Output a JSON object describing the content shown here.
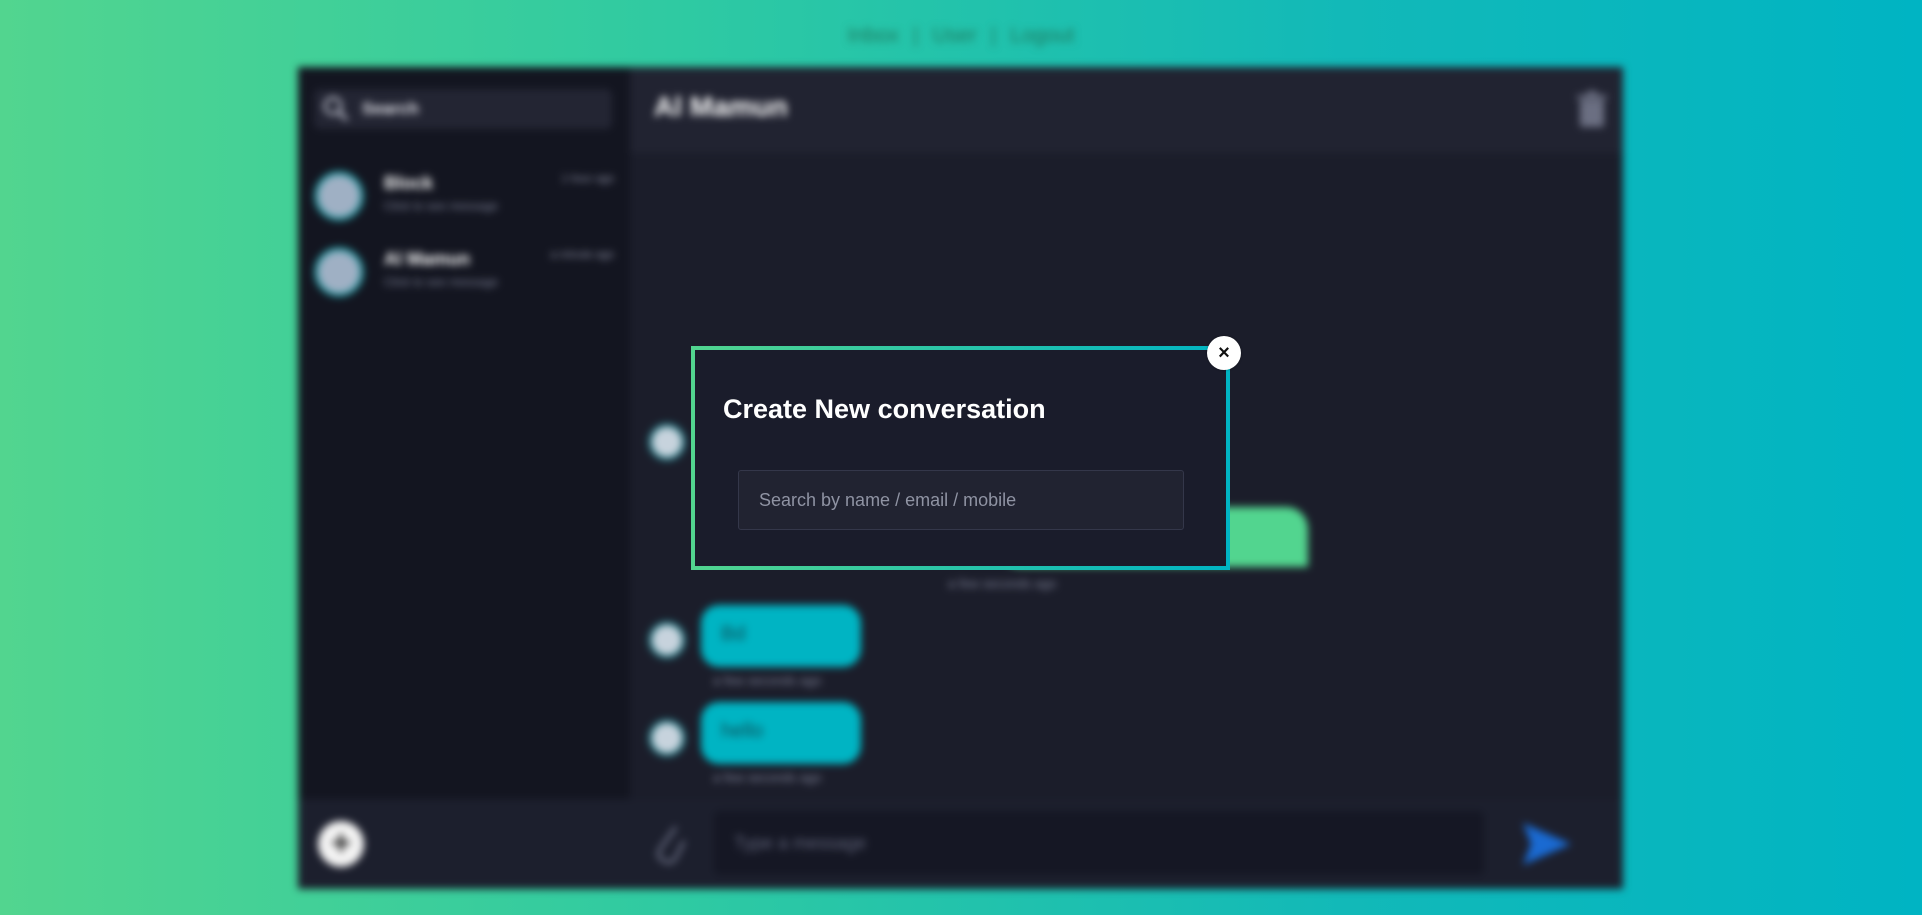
{
  "nav": {
    "items": [
      "Inbox",
      "User",
      "Logout"
    ]
  },
  "sidebar": {
    "search_placeholder": "Search",
    "conversations": [
      {
        "name": "Block",
        "subtitle": "Click to see message",
        "time": "1 hour ago"
      },
      {
        "name": "Al Mamun",
        "subtitle": "Click to see message",
        "time": "a minute ago"
      }
    ],
    "add_label": "+"
  },
  "chat": {
    "title": "Al Mamun",
    "messages": [
      {
        "text": "",
        "meta": "a few seconds ago"
      },
      {
        "text": "Bd",
        "meta": "a few seconds ago"
      },
      {
        "text": "hello",
        "meta": "a few seconds ago"
      }
    ],
    "composer_placeholder": "Type a message"
  },
  "modal": {
    "title": "Create New conversation",
    "search_placeholder": "Search by name / email / mobile",
    "close_label": "×"
  },
  "colors": {
    "accent_green": "#52d58f",
    "accent_teal": "#00b4c3",
    "panel": "#1b1d2a"
  }
}
